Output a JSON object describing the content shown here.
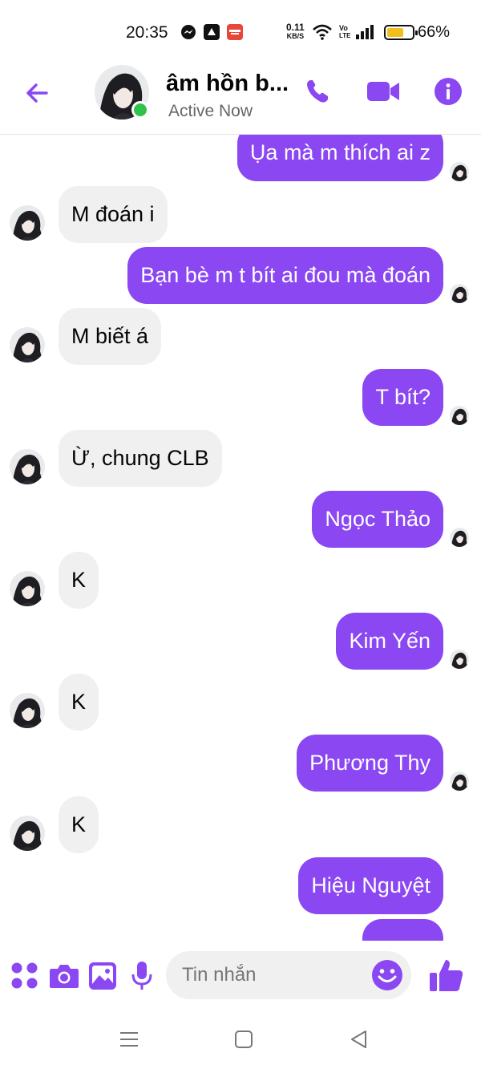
{
  "status_bar": {
    "time": "20:35",
    "net_speed_value": "0.11",
    "net_speed_unit": "KB/S",
    "volte_top": "Vo",
    "volte_bottom": "LTE",
    "battery_percent": "66%",
    "battery_level": 0.66
  },
  "header": {
    "contact_name": "âm hồn b...",
    "status": "Active Now",
    "accent_color": "#8a47f2"
  },
  "messages": [
    {
      "direction": "outgoing",
      "text": "Ụa mà m thích ai z"
    },
    {
      "direction": "incoming",
      "text": "M đoán i"
    },
    {
      "direction": "outgoing",
      "text": "Bạn bè m t bít ai đou mà đoán"
    },
    {
      "direction": "incoming",
      "text": "M biết á"
    },
    {
      "direction": "outgoing",
      "text": "T bít?"
    },
    {
      "direction": "incoming",
      "text": "Ừ, chung CLB"
    },
    {
      "direction": "outgoing",
      "text": "Ngọc Thảo"
    },
    {
      "direction": "incoming",
      "text": "K"
    },
    {
      "direction": "outgoing",
      "text": "Kim Yến"
    },
    {
      "direction": "incoming",
      "text": "K"
    },
    {
      "direction": "outgoing",
      "text": "Phương Thy"
    },
    {
      "direction": "incoming",
      "text": "K"
    },
    {
      "direction": "outgoing",
      "text": "Hiệu Nguyệt"
    }
  ],
  "composer": {
    "placeholder": "Tin nhắn",
    "icons": [
      "apps-icon",
      "camera-icon",
      "gallery-icon",
      "microphone-icon",
      "emoji-icon",
      "thumbs-up-icon"
    ]
  },
  "nav_bar": {
    "icons": [
      "menu-icon",
      "home-icon",
      "back-icon"
    ]
  }
}
